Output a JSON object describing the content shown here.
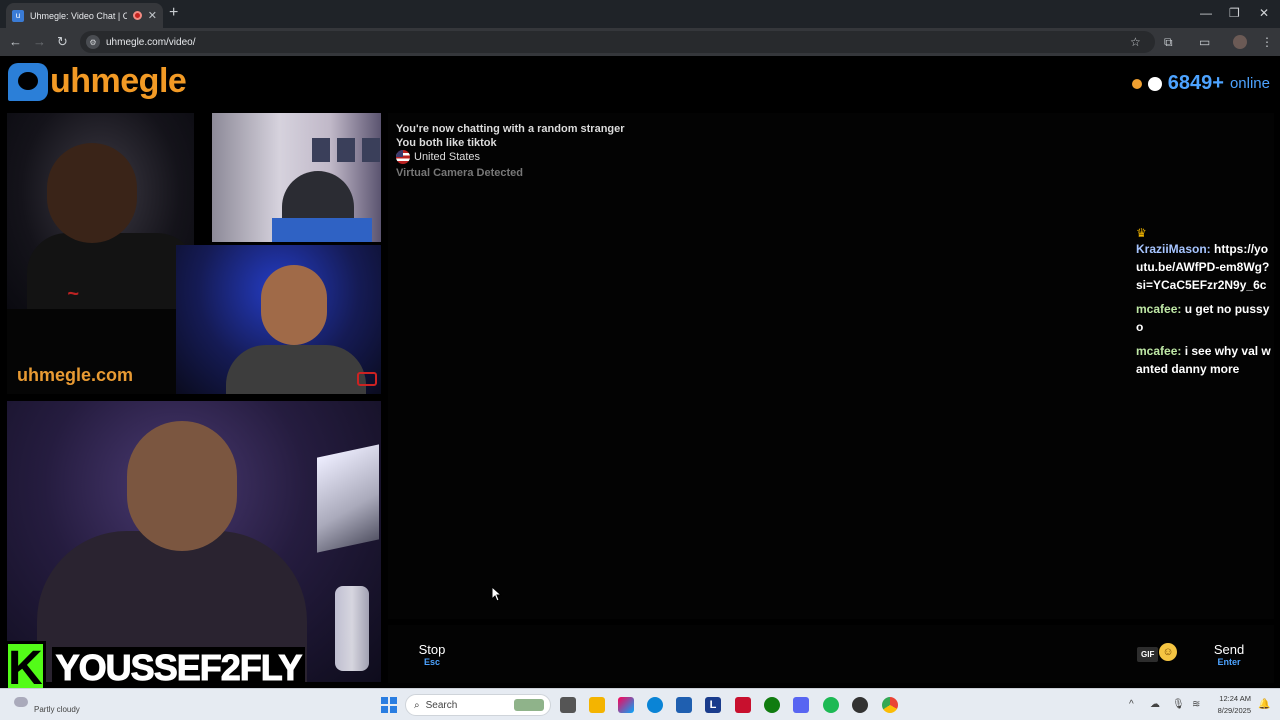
{
  "browser": {
    "tab_title": "Uhmegle: Video Chat | Ome",
    "url": "uhmegle.com/video/",
    "new_tab_symbol": "+",
    "close_symbol": "✕"
  },
  "site": {
    "logo_text": "uhmegle",
    "online_count": "6849+",
    "online_label": "online"
  },
  "video": {
    "watermark": "uhmegle.com",
    "streamer_overlay_letter": "K",
    "streamer_name": "YOUSSEF2FLY"
  },
  "chat": {
    "system_lines": [
      "You're now chatting with a random stranger",
      "You both like tiktok",
      "United States",
      "Virtual Camera Detected"
    ],
    "messages": [
      {
        "user": "KraziiMason:",
        "text": "https://youtu.be/AWfPD-em8Wg?si=YCaC5EFzr2N9y_6c"
      },
      {
        "user": "mcafee:",
        "text": "u get no pussy o"
      },
      {
        "user": "mcafee:",
        "text": "i see why val wanted danny more"
      }
    ]
  },
  "controls": {
    "stop_label": "Stop",
    "stop_key": "Esc",
    "gif_label": "GIF",
    "send_label": "Send",
    "send_key": "Enter"
  },
  "taskbar": {
    "weather": "Partly cloudy",
    "search_placeholder": "Search",
    "time": "12:24 AM",
    "date": "8/29/2025"
  },
  "colors": {
    "accent_blue": "#4da3ff",
    "logo_orange": "#f29a25",
    "kick_green": "#53fc18"
  }
}
